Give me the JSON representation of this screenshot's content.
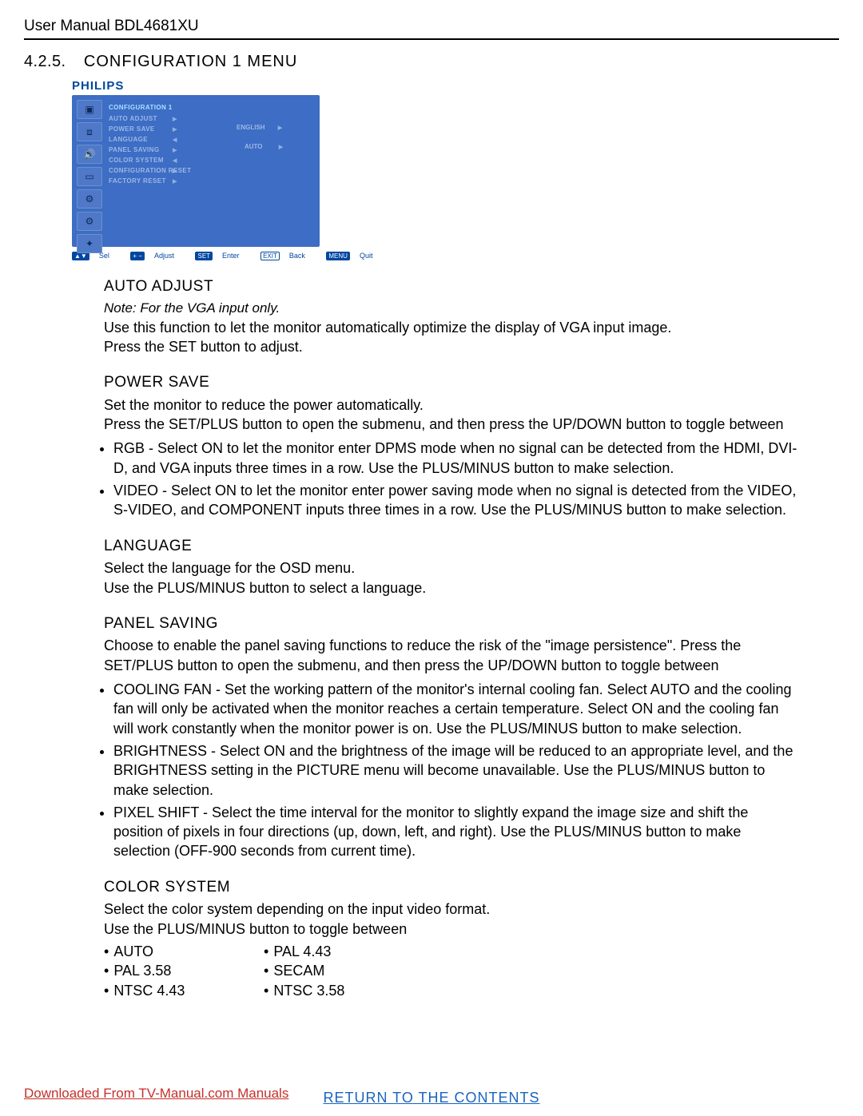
{
  "header": "User Manual BDL4681XU",
  "section_num": "4.2.5.",
  "section_title": "CONFIGURATION 1 MENU",
  "brand": "PHILIPS",
  "osd": {
    "title": "CONFIGURATION 1",
    "items": [
      "AUTO ADJUST",
      "POWER SAVE",
      "LANGUAGE",
      "PANEL SAVING",
      "COLOR SYSTEM",
      "CONFIGURATION RESET",
      "FACTORY RESET"
    ],
    "lang_value": "ENGLISH",
    "cs_value": "AUTO"
  },
  "legend": {
    "sel": "Sel",
    "adjust": "Adjust",
    "set": "SET",
    "enter": "Enter",
    "exit": "EXIT",
    "back": "Back",
    "menu": "MENU",
    "quit": "Quit"
  },
  "auto_adjust": {
    "h": "AUTO ADJUST",
    "note": "Note: For the VGA input only.",
    "p1": "Use this function to let the monitor automatically optimize the display of VGA input image.",
    "p2": "Press the SET button to adjust."
  },
  "power_save": {
    "h": "POWER SAVE",
    "p1": "Set the monitor to reduce the power automatically.",
    "p2": "Press the SET/PLUS button to open the submenu, and then press the UP/DOWN button to toggle between",
    "b1": "RGB - Select ON to let the monitor enter DPMS mode when no signal can be detected from the HDMI, DVI-D, and VGA inputs three times in a row. Use the PLUS/MINUS button to make selection.",
    "b2": "VIDEO - Select ON to let the monitor enter power saving mode when no signal is detected from the VIDEO, S-VIDEO, and COMPONENT inputs three times in a row. Use the PLUS/MINUS button to make selection."
  },
  "language": {
    "h": "LANGUAGE",
    "p1": "Select the language for the OSD menu.",
    "p2": "Use the PLUS/MINUS button to select a language."
  },
  "panel_saving": {
    "h": "PANEL SAVING",
    "p1": "Choose to enable the panel saving functions to reduce the risk of the \"image persistence\". Press the SET/PLUS button to open the submenu, and then press the UP/DOWN button to toggle between",
    "b1": "COOLING FAN - Set the working pattern of the monitor's internal cooling fan. Select AUTO and the cooling fan will only be activated when the monitor reaches a certain temperature. Select ON and the cooling fan will work constantly when the monitor power is on. Use the PLUS/MINUS button to make selection.",
    "b2": "BRIGHTNESS - Select ON and the brightness of the image will be reduced to an appropriate level, and the BRIGHTNESS setting in the PICTURE menu will become unavailable. Use the PLUS/MINUS button to make selection.",
    "b3": "PIXEL SHIFT - Select the time interval for the monitor to slightly expand the image size and shift the position of pixels in four directions (up, down, left, and right). Use the PLUS/MINUS button to make selection (OFF-900 seconds from current time)."
  },
  "color_system": {
    "h": "COLOR SYSTEM",
    "p1": "Select the color system depending on the input video format.",
    "p2": "Use the PLUS/MINUS button to toggle between",
    "colA": [
      "AUTO",
      "PAL 3.58",
      "NTSC 4.43"
    ],
    "colB": [
      "PAL 4.43",
      "SECAM",
      "NTSC 3.58"
    ]
  },
  "footer_dl": "Downloaded From TV-Manual.com Manuals",
  "footer_ret": "RETURN TO THE CONTENTS"
}
